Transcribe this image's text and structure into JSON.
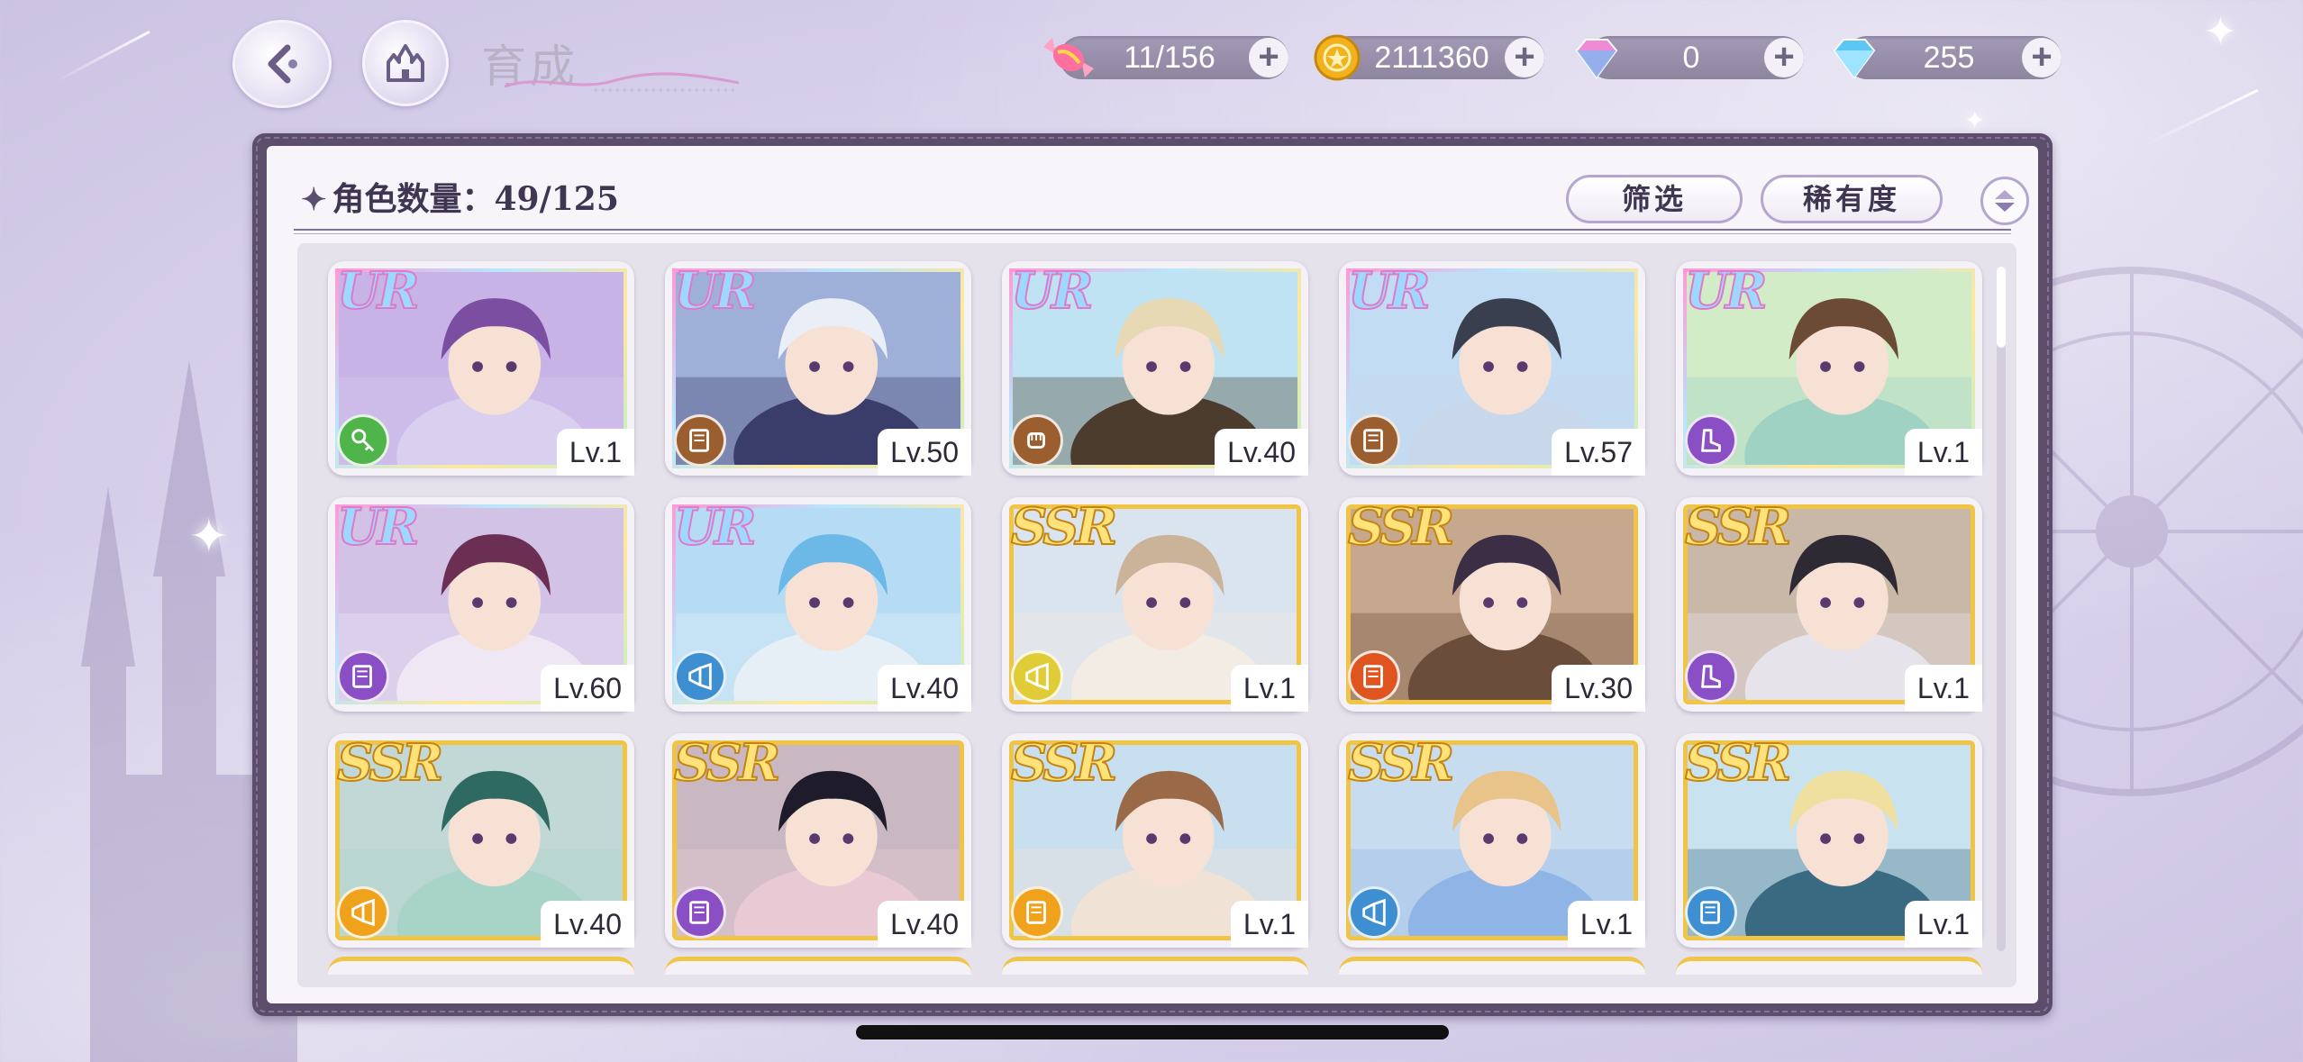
{
  "header": {
    "title": "育成",
    "currencies": [
      {
        "name": "candy-icon",
        "value": "11/156",
        "color": "#ff6fa0"
      },
      {
        "name": "gold-coin-icon",
        "value": "2111360",
        "color": "#f2b21d"
      },
      {
        "name": "pink-diamond-icon",
        "value": "0",
        "color": "#f08ad6"
      },
      {
        "name": "blue-diamond-icon",
        "value": "255",
        "color": "#5cc7f2"
      }
    ]
  },
  "panel": {
    "count_label": "角色数量：49/125",
    "filter_label": "筛选",
    "rarity_label": "稀有度"
  },
  "cards": [
    {
      "rarity": "UR",
      "level": "Lv.1",
      "role": "key",
      "role_color": "#4fb54a",
      "palette": [
        "#c7b3e6",
        "#7b4ea2",
        "#d9cfee"
      ]
    },
    {
      "rarity": "UR",
      "level": "Lv.50",
      "role": "book",
      "role_color": "#9b5e2e",
      "palette": [
        "#9fb0d8",
        "#eaeef7",
        "#3a3d6a"
      ]
    },
    {
      "rarity": "UR",
      "level": "Lv.40",
      "role": "fist",
      "role_color": "#9b5e2e",
      "palette": [
        "#bfe3f2",
        "#e8d9b5",
        "#4b3c2e"
      ]
    },
    {
      "rarity": "UR",
      "level": "Lv.57",
      "role": "book",
      "role_color": "#9b5e2e",
      "palette": [
        "#c1dcf3",
        "#3a3f4f",
        "#c8d8ea"
      ]
    },
    {
      "rarity": "UR",
      "level": "Lv.1",
      "role": "boot",
      "role_color": "#8a4fc4",
      "palette": [
        "#d3ecc8",
        "#6b4a36",
        "#9fd2c2"
      ]
    },
    {
      "rarity": "UR",
      "level": "Lv.60",
      "role": "book",
      "role_color": "#8a4fc4",
      "palette": [
        "#d2c2e6",
        "#6a2f53",
        "#efe8f4"
      ]
    },
    {
      "rarity": "UR",
      "level": "Lv.40",
      "role": "horn",
      "role_color": "#3d8fd1",
      "palette": [
        "#b6dcf5",
        "#6cb8e6",
        "#e6eef6"
      ]
    },
    {
      "rarity": "SSR",
      "level": "Lv.1",
      "role": "horn",
      "role_color": "#e0cc36",
      "palette": [
        "#d9e4ef",
        "#cbb39a",
        "#f3ece4"
      ]
    },
    {
      "rarity": "SSR",
      "level": "Lv.30",
      "role": "book",
      "role_color": "#e0541f",
      "palette": [
        "#c6a88f",
        "#3c2e45",
        "#6a4d3a"
      ]
    },
    {
      "rarity": "SSR",
      "level": "Lv.1",
      "role": "boot",
      "role_color": "#8a4fc4",
      "palette": [
        "#c9b8a8",
        "#2d2a34",
        "#e6e3ea"
      ]
    },
    {
      "rarity": "SSR",
      "level": "Lv.40",
      "role": "horn",
      "role_color": "#f0a21c",
      "palette": [
        "#c2d8d6",
        "#2f6a62",
        "#a8d4c8"
      ]
    },
    {
      "rarity": "SSR",
      "level": "Lv.40",
      "role": "book",
      "role_color": "#8a4fc4",
      "palette": [
        "#c9b8c2",
        "#1e1c2a",
        "#e8c9d4"
      ]
    },
    {
      "rarity": "SSR",
      "level": "Lv.1",
      "role": "book",
      "role_color": "#f0a21c",
      "palette": [
        "#c8dff0",
        "#9a6a48",
        "#f0e2d4"
      ]
    },
    {
      "rarity": "SSR",
      "level": "Lv.1",
      "role": "horn",
      "role_color": "#3d8fd1",
      "palette": [
        "#c8dcef",
        "#e8c48a",
        "#8fb5e6"
      ]
    },
    {
      "rarity": "SSR",
      "level": "Lv.1",
      "role": "book",
      "role_color": "#3d8fd1",
      "palette": [
        "#c9e2f0",
        "#efe0a0",
        "#3a6a82"
      ]
    }
  ]
}
